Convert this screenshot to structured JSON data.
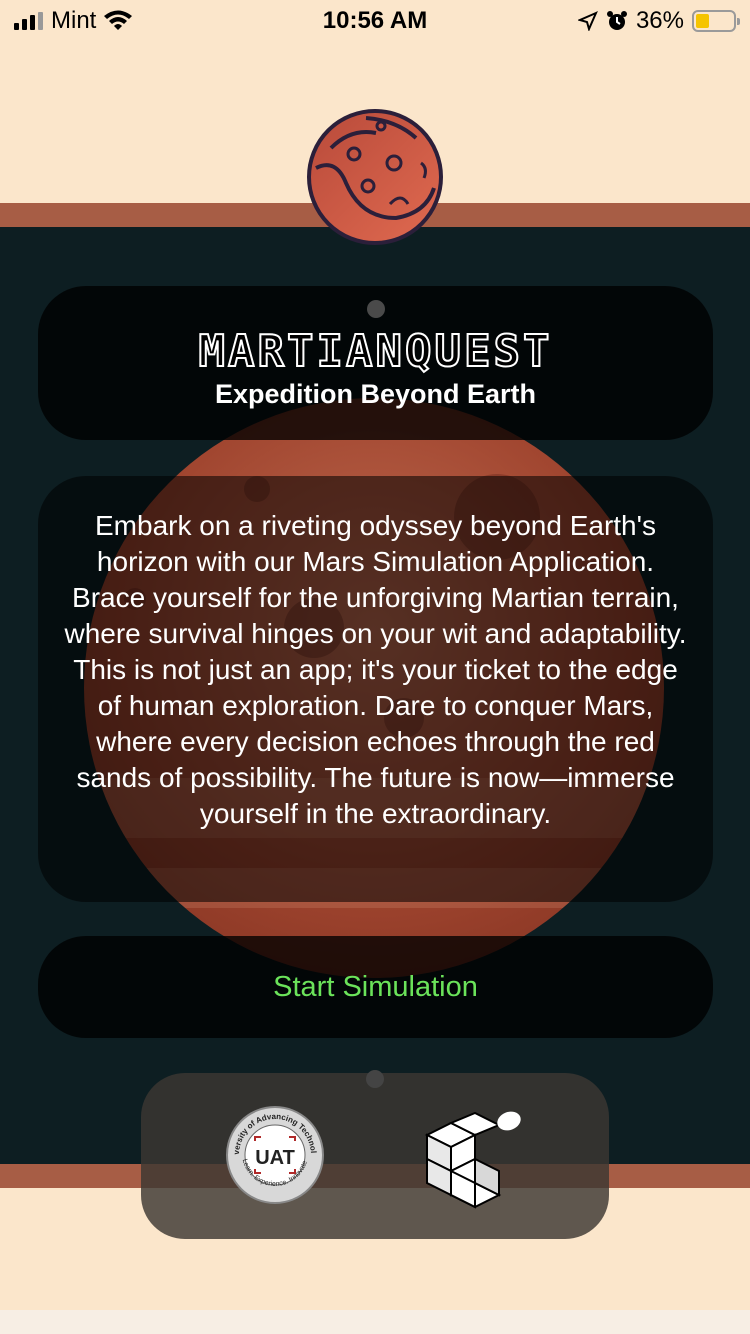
{
  "status_bar": {
    "carrier": "Mint",
    "time": "10:56 AM",
    "battery_percent": "36%",
    "battery_level": 0.36,
    "icons": [
      "signal-icon",
      "wifi-icon",
      "location-icon",
      "alarm-icon",
      "battery-icon"
    ]
  },
  "header": {
    "app_title": "MARTIANQUEST",
    "subtitle": "Expedition Beyond Earth"
  },
  "description": "Embark on a riveting odyssey beyond Earth's horizon with our Mars Simulation Application. Brace yourself for the unforgiving Martian terrain, where survival hinges on your wit and adaptability. This is not just an app; it's your ticket to the edge of human exploration. Dare to conquer Mars, where every decision echoes through the red sands of possibility. The future is now—immerse yourself in the extraordinary.",
  "actions": {
    "start_label": "Start Simulation"
  },
  "partners": {
    "uat_arc_text": "University of Advancing Technology",
    "uat_initials": "UAT",
    "uat_tagline": "Learn. Experience. Innovate.",
    "cube_logo": "cube-logo-icon"
  },
  "colors": {
    "background": "#fbe6cb",
    "stripe": "#a75d45",
    "dark": "#0d1e22",
    "accent_green": "#6be35a",
    "mars": "#c75a44"
  }
}
